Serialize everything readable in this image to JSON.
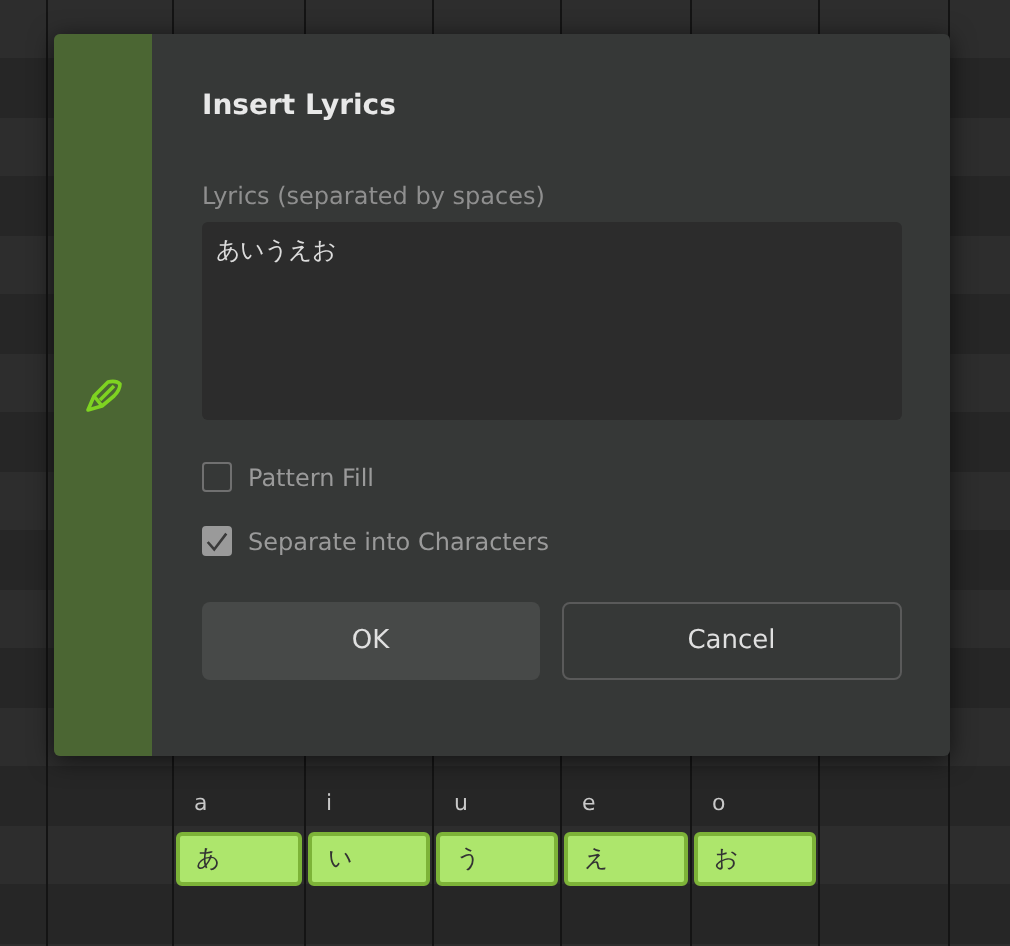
{
  "dialog": {
    "title": "Insert Lyrics",
    "field_label": "Lyrics (separated by spaces)",
    "lyrics_value": "あいうえお",
    "options": [
      {
        "label": "Pattern Fill",
        "checked": false
      },
      {
        "label": "Separate into Characters",
        "checked": true
      }
    ],
    "buttons": [
      {
        "label": "OK",
        "kind": "primary"
      },
      {
        "label": "Cancel",
        "kind": "secondary"
      }
    ]
  },
  "notes": [
    {
      "phoneme": "a",
      "lyric": "あ"
    },
    {
      "phoneme": "i",
      "lyric": "い"
    },
    {
      "phoneme": "u",
      "lyric": "う"
    },
    {
      "phoneme": "e",
      "lyric": "え"
    },
    {
      "phoneme": "o",
      "lyric": "お"
    }
  ]
}
